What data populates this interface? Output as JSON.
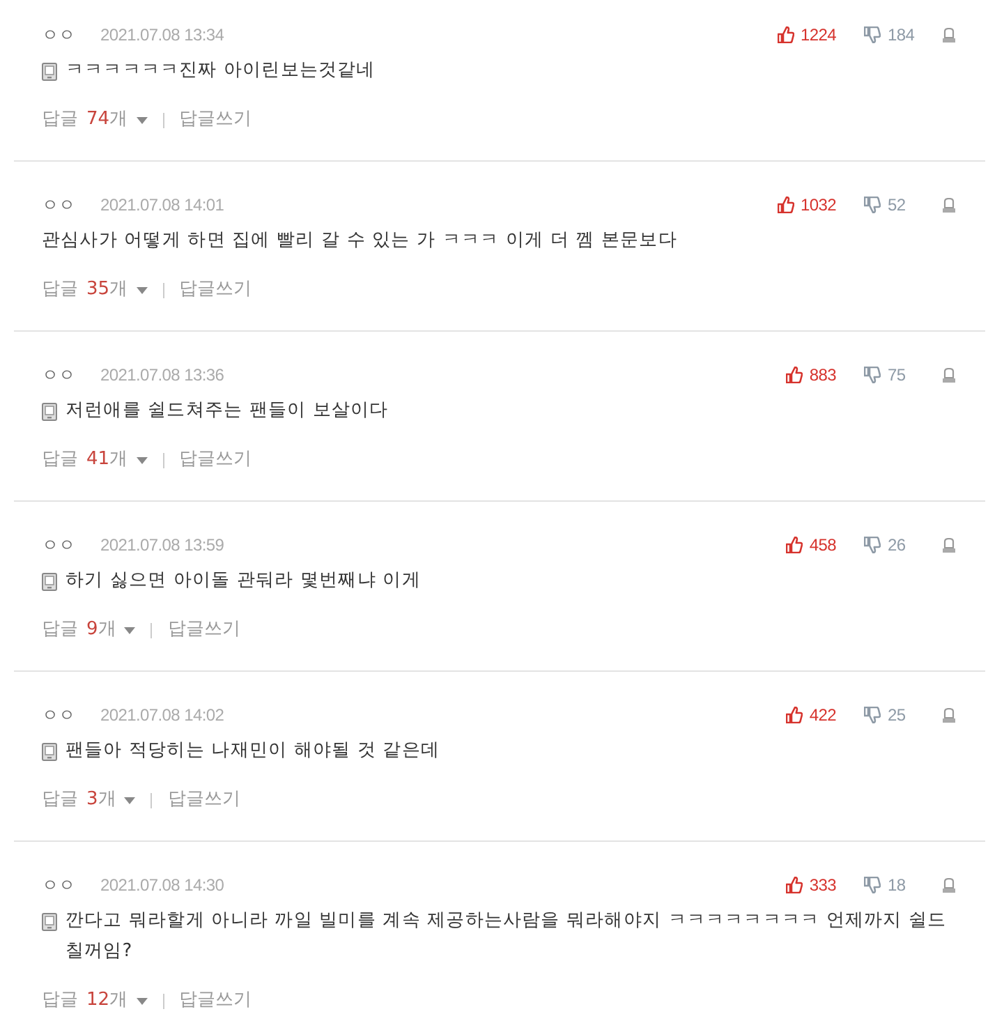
{
  "comments": [
    {
      "author": "ㅇㅇ",
      "date": "2021.07.08 13:34",
      "likes": "1224",
      "dislikes": "184",
      "mobile": true,
      "text": "ㅋㅋㅋㅋㅋㅋ진짜 아이린보는것같네",
      "reply_button": {
        "label": "답글",
        "count": "74",
        "unit": "개"
      },
      "write_reply": "답글쓰기"
    },
    {
      "author": "ㅇㅇ",
      "date": "2021.07.08 14:01",
      "likes": "1032",
      "dislikes": "52",
      "mobile": false,
      "text": "관심사가 어떻게 하면 집에 빨리 갈 수 있는 가 ㅋㅋㅋ 이게 더 껨 본문보다",
      "reply_button": {
        "label": "답글",
        "count": "35",
        "unit": "개"
      },
      "write_reply": "답글쓰기"
    },
    {
      "author": "ㅇㅇ",
      "date": "2021.07.08 13:36",
      "likes": "883",
      "dislikes": "75",
      "mobile": true,
      "text": "저런애를 쉴드쳐주는 팬들이 보살이다",
      "reply_button": {
        "label": "답글",
        "count": "41",
        "unit": "개"
      },
      "write_reply": "답글쓰기"
    },
    {
      "author": "ㅇㅇ",
      "date": "2021.07.08 13:59",
      "likes": "458",
      "dislikes": "26",
      "mobile": true,
      "text": "하기 싫으면 아이돌 관둬라 몇번째냐 이게",
      "reply_button": {
        "label": "답글",
        "count": "9",
        "unit": "개"
      },
      "write_reply": "답글쓰기"
    },
    {
      "author": "ㅇㅇ",
      "date": "2021.07.08 14:02",
      "likes": "422",
      "dislikes": "25",
      "mobile": true,
      "text": "팬들아 적당히는 나재민이 해야될 것 같은데",
      "reply_button": {
        "label": "답글",
        "count": "3",
        "unit": "개"
      },
      "write_reply": "답글쓰기"
    },
    {
      "author": "ㅇㅇ",
      "date": "2021.07.08 14:30",
      "likes": "333",
      "dislikes": "18",
      "mobile": true,
      "text": "깐다고 뭐라할게 아니라 까일 빌미를 계속 제공하는사람을 뭐라해야지 ㅋㅋㅋㅋㅋㅋㅋㅋ 언제까지 쉴드 칠꺼임?",
      "reply_button": {
        "label": "답글",
        "count": "12",
        "unit": "개"
      },
      "write_reply": "답글쓰기"
    }
  ]
}
